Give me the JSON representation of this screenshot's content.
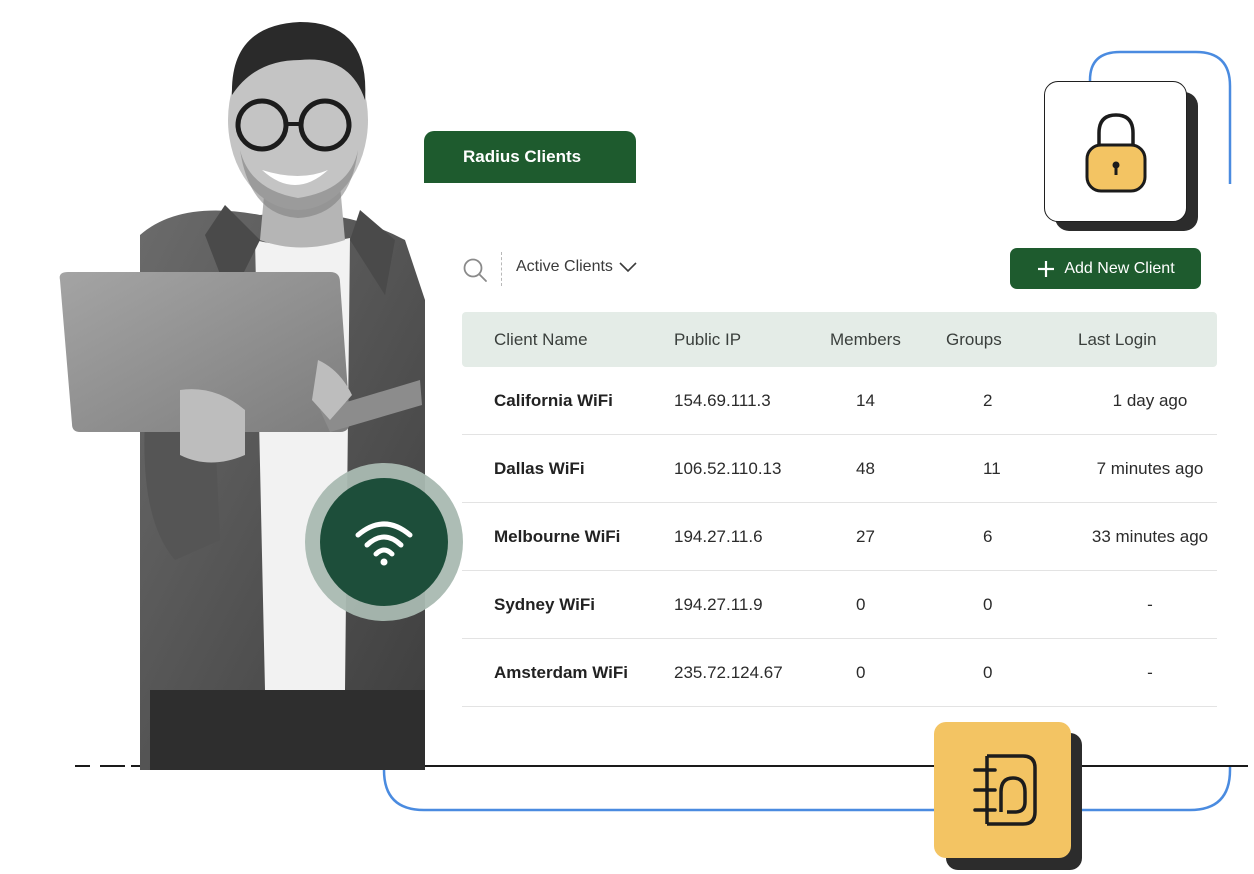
{
  "tab": {
    "label": "Radius Clients"
  },
  "toolbar": {
    "search_icon": "search-icon",
    "filter_label": "Active Clients",
    "filter_icon": "chevron-down-icon",
    "add_button_label": "Add New Client",
    "add_button_icon": "plus-icon"
  },
  "table": {
    "headers": [
      "Client Name",
      "Public IP",
      "Members",
      "Groups",
      "Last Login"
    ],
    "rows": [
      {
        "name": "California WiFi",
        "ip": "154.69.111.3",
        "members": "14",
        "groups": "2",
        "last_login": "1 day ago"
      },
      {
        "name": "Dallas WiFi",
        "ip": "106.52.110.13",
        "members": "48",
        "groups": "11",
        "last_login": "7 minutes ago"
      },
      {
        "name": "Melbourne WiFi",
        "ip": "194.27.11.6",
        "members": "27",
        "groups": "6",
        "last_login": "33 minutes ago"
      },
      {
        "name": "Sydney WiFi",
        "ip": "194.27.11.9",
        "members": "0",
        "groups": "0",
        "last_login": "-"
      },
      {
        "name": "Amsterdam WiFi",
        "ip": "235.72.124.67",
        "members": "0",
        "groups": "0",
        "last_login": "-"
      }
    ]
  },
  "decor": {
    "lock_icon": "padlock-icon",
    "directory_icon": "directory-book-icon",
    "wifi_icon": "wifi-icon"
  },
  "colors": {
    "brand_green": "#1e5b2e",
    "header_tint": "#e4ece7",
    "accent_yellow": "#f3c463",
    "connector_blue": "#4a8be0",
    "wifi_dark": "#1d4e3a"
  }
}
